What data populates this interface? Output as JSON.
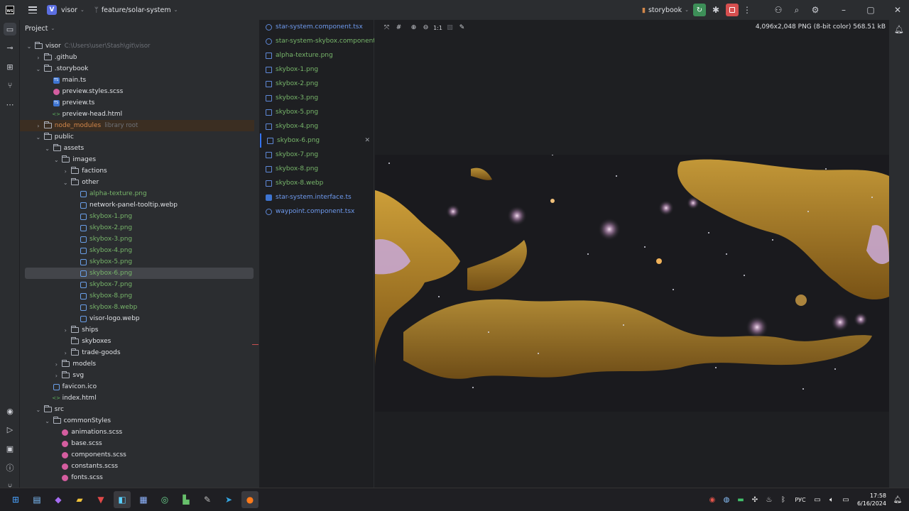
{
  "titlebar": {
    "project_badge": "V",
    "project_name": "visor",
    "branch": "feature/solar-system",
    "run_config": "storybook"
  },
  "project_panel": {
    "title": "Project",
    "tree": [
      {
        "label": "visor",
        "hint": "C:\\Users\\user\\Stash\\git\\visor",
        "kind": "folder",
        "open": true,
        "depth": 0
      },
      {
        "label": ".github",
        "kind": "folder",
        "open": false,
        "depth": 1
      },
      {
        "label": ".storybook",
        "kind": "folder",
        "open": true,
        "depth": 1
      },
      {
        "label": "main.ts",
        "kind": "ts",
        "depth": 2
      },
      {
        "label": "preview.styles.scss",
        "kind": "scss",
        "depth": 2
      },
      {
        "label": "preview.ts",
        "kind": "ts",
        "depth": 2
      },
      {
        "label": "preview-head.html",
        "kind": "html",
        "depth": 2
      },
      {
        "label": "node_modules",
        "hint": "library root",
        "kind": "folder",
        "open": false,
        "depth": 1,
        "style": "orange",
        "lib": true
      },
      {
        "label": "public",
        "kind": "folder",
        "open": true,
        "depth": 1
      },
      {
        "label": "assets",
        "kind": "folder",
        "open": true,
        "depth": 2
      },
      {
        "label": "images",
        "kind": "folder",
        "open": true,
        "depth": 3
      },
      {
        "label": "factions",
        "kind": "folder",
        "open": false,
        "depth": 4
      },
      {
        "label": "other",
        "kind": "folder",
        "open": true,
        "depth": 4
      },
      {
        "label": "alpha-texture.png",
        "kind": "img",
        "depth": 5,
        "style": "green"
      },
      {
        "label": "network-panel-tooltip.webp",
        "kind": "img",
        "depth": 5
      },
      {
        "label": "skybox-1.png",
        "kind": "img",
        "depth": 5,
        "style": "green"
      },
      {
        "label": "skybox-2.png",
        "kind": "img",
        "depth": 5,
        "style": "green"
      },
      {
        "label": "skybox-3.png",
        "kind": "img",
        "depth": 5,
        "style": "green"
      },
      {
        "label": "skybox-4.png",
        "kind": "img",
        "depth": 5,
        "style": "green"
      },
      {
        "label": "skybox-5.png",
        "kind": "img",
        "depth": 5,
        "style": "green"
      },
      {
        "label": "skybox-6.png",
        "kind": "img",
        "depth": 5,
        "style": "green",
        "selected": true
      },
      {
        "label": "skybox-7.png",
        "kind": "img",
        "depth": 5,
        "style": "green"
      },
      {
        "label": "skybox-8.png",
        "kind": "img",
        "depth": 5,
        "style": "green"
      },
      {
        "label": "skybox-8.webp",
        "kind": "img",
        "depth": 5,
        "style": "green"
      },
      {
        "label": "visor-logo.webp",
        "kind": "img",
        "depth": 5
      },
      {
        "label": "ships",
        "kind": "folder",
        "open": false,
        "depth": 4
      },
      {
        "label": "skyboxes",
        "kind": "folder",
        "depth": 4,
        "noarrow": true
      },
      {
        "label": "trade-goods",
        "kind": "folder",
        "open": false,
        "depth": 4
      },
      {
        "label": "models",
        "kind": "folder",
        "open": false,
        "depth": 3
      },
      {
        "label": "svg",
        "kind": "folder",
        "open": false,
        "depth": 3
      },
      {
        "label": "favicon.ico",
        "kind": "ico",
        "depth": 2
      },
      {
        "label": "index.html",
        "kind": "html",
        "depth": 2
      },
      {
        "label": "src",
        "kind": "folder",
        "open": true,
        "depth": 1
      },
      {
        "label": "commonStyles",
        "kind": "folder",
        "open": true,
        "depth": 2
      },
      {
        "label": "animations.scss",
        "kind": "scss",
        "depth": 3
      },
      {
        "label": "base.scss",
        "kind": "scss",
        "depth": 3
      },
      {
        "label": "components.scss",
        "kind": "scss",
        "depth": 3
      },
      {
        "label": "constants.scss",
        "kind": "scss",
        "depth": 3
      },
      {
        "label": "fonts.scss",
        "kind": "scss",
        "depth": 3
      }
    ]
  },
  "open_files": [
    {
      "label": "star-system.component.tsx",
      "kind": "react",
      "style": "blue"
    },
    {
      "label": "star-system-skybox.component.tsx",
      "kind": "react",
      "style": "green"
    },
    {
      "label": "alpha-texture.png",
      "kind": "img",
      "style": "green"
    },
    {
      "label": "skybox-1.png",
      "kind": "img",
      "style": "green"
    },
    {
      "label": "skybox-2.png",
      "kind": "img",
      "style": "green"
    },
    {
      "label": "skybox-3.png",
      "kind": "img",
      "style": "green"
    },
    {
      "label": "skybox-5.png",
      "kind": "img",
      "style": "green"
    },
    {
      "label": "skybox-4.png",
      "kind": "img",
      "style": "green"
    },
    {
      "label": "skybox-6.png",
      "kind": "img",
      "style": "green",
      "active": true
    },
    {
      "label": "skybox-7.png",
      "kind": "img",
      "style": "green"
    },
    {
      "label": "skybox-8.png",
      "kind": "img",
      "style": "green"
    },
    {
      "label": "skybox-8.webp",
      "kind": "img",
      "style": "green"
    },
    {
      "label": "star-system.interface.ts",
      "kind": "ts",
      "style": "blue"
    },
    {
      "label": "waypoint.component.tsx",
      "kind": "react",
      "style": "blue"
    }
  ],
  "viewer": {
    "zoom_actual": "1:1",
    "image_info": "4,096x2,048 PNG (8-bit color) 568.51 kB"
  },
  "taskbar": {
    "lang": "РУС",
    "time": "17:58",
    "date": "6/16/2024"
  },
  "colors": {
    "accent": "#3574f0",
    "green_file": "#77b56a",
    "blue_file": "#6f9bf0",
    "library": "#d2874a",
    "nebula_gold": "#c9962a",
    "nebula_lilac": "#c7a6cf"
  }
}
